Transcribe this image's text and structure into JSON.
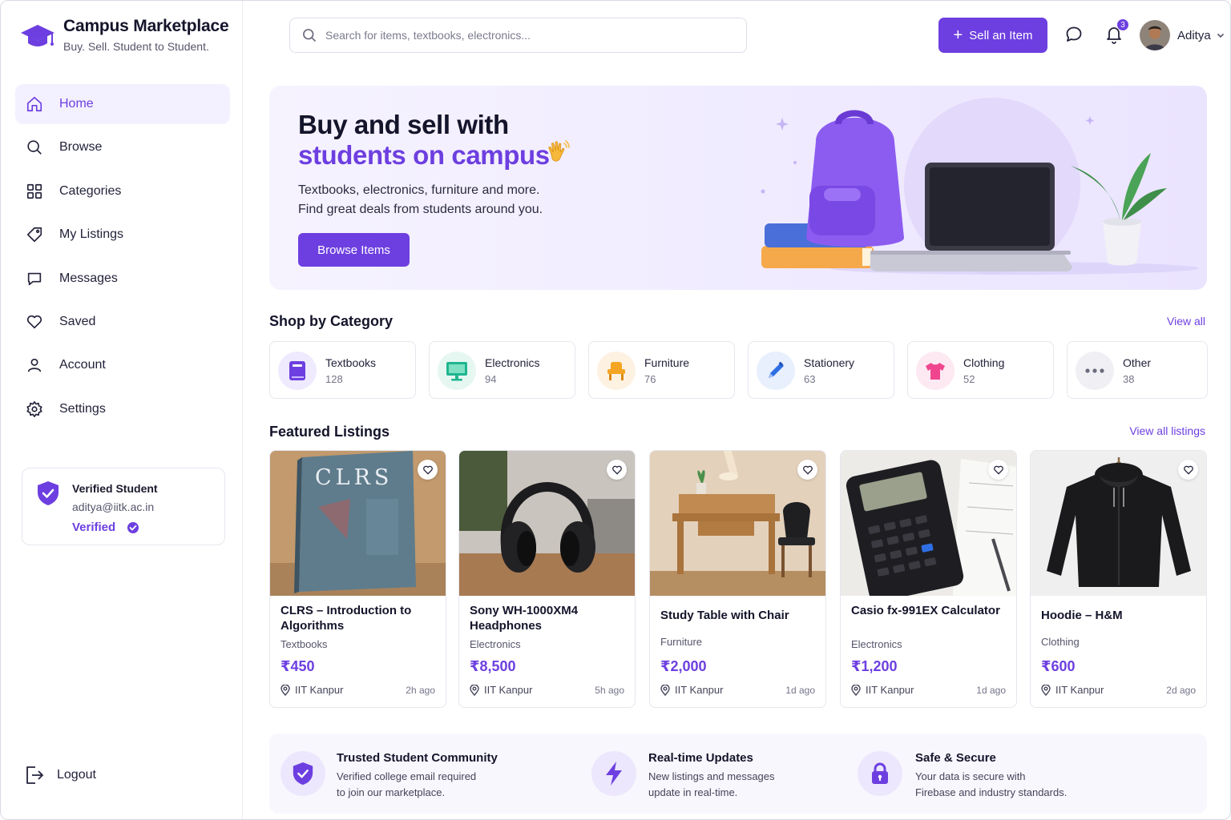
{
  "brand": {
    "title": "Campus Marketplace",
    "tagline": "Buy. Sell. Student to Student."
  },
  "nav": {
    "items": [
      {
        "label": "Home",
        "icon": "home-icon",
        "active": true
      },
      {
        "label": "Browse",
        "icon": "search-icon"
      },
      {
        "label": "Categories",
        "icon": "grid-icon"
      },
      {
        "label": "My Listings",
        "icon": "tag-icon"
      },
      {
        "label": "Messages",
        "icon": "chat-icon"
      },
      {
        "label": "Saved",
        "icon": "heart-icon"
      },
      {
        "label": "Account",
        "icon": "user-icon"
      },
      {
        "label": "Settings",
        "icon": "gear-icon"
      }
    ],
    "logout": "Logout"
  },
  "verified_card": {
    "title": "Verified Student",
    "email": "aditya@iitk.ac.in",
    "status": "Verified"
  },
  "header": {
    "search_placeholder": "Search for items, textbooks, electronics...",
    "sell_label": "Sell an Item",
    "notification_count": "3",
    "user_name": "Aditya"
  },
  "hero": {
    "line1": "Buy and sell with",
    "line2": "students on campus",
    "desc1": "Textbooks, electronics, furniture and more.",
    "desc2": "Find great deals from students around you.",
    "button": "Browse Items"
  },
  "categories": {
    "title": "Shop by Category",
    "view_all": "View all",
    "items": [
      {
        "name": "Textbooks",
        "count": "128",
        "icon": "book-icon",
        "color": "#6d3fe0",
        "bg": "#efeafe"
      },
      {
        "name": "Electronics",
        "count": "94",
        "icon": "monitor-icon",
        "color": "#1fb58f",
        "bg": "#e6f7f1"
      },
      {
        "name": "Furniture",
        "count": "76",
        "icon": "chair-icon",
        "color": "#f5a524",
        "bg": "#fdf1e2"
      },
      {
        "name": "Stationery",
        "count": "63",
        "icon": "pencil-icon",
        "color": "#2f6fe4",
        "bg": "#e8effd"
      },
      {
        "name": "Clothing",
        "count": "52",
        "icon": "tshirt-icon",
        "color": "#f0468f",
        "bg": "#fde9f2"
      },
      {
        "name": "Other",
        "count": "38",
        "icon": "more-icon",
        "color": "#6b6b80",
        "bg": "#f0f0f4"
      }
    ]
  },
  "featured": {
    "title": "Featured Listings",
    "view_all": "View all listings",
    "items": [
      {
        "title": "CLRS – Introduction to Algorithms",
        "category": "Textbooks",
        "price": "₹450",
        "location": "IIT Kanpur",
        "time": "2h ago",
        "image": "book-photo",
        "image_text": "CLRS"
      },
      {
        "title": "Sony WH-1000XM4 Headphones",
        "category": "Electronics",
        "price": "₹8,500",
        "location": "IIT Kanpur",
        "time": "5h ago",
        "image": "headphones-photo"
      },
      {
        "title": "Study Table with Chair",
        "category": "Furniture",
        "price": "₹2,000",
        "location": "IIT Kanpur",
        "time": "1d ago",
        "image": "table-photo"
      },
      {
        "title": "Casio fx-991EX Calculator",
        "category": "Electronics",
        "price": "₹1,200",
        "location": "IIT Kanpur",
        "time": "1d ago",
        "image": "calculator-photo"
      },
      {
        "title": "Hoodie – H&M",
        "category": "Clothing",
        "price": "₹600",
        "location": "IIT Kanpur",
        "time": "2d ago",
        "image": "hoodie-photo"
      }
    ]
  },
  "features": [
    {
      "title": "Trusted Student Community",
      "line1": "Verified college email required",
      "line2": "to join our marketplace.",
      "icon": "shield-check-icon"
    },
    {
      "title": "Real-time Updates",
      "line1": "New listings and messages",
      "line2": "update in real-time.",
      "icon": "bolt-icon"
    },
    {
      "title": "Safe & Secure",
      "line1": "Your data is secure with",
      "line2": "Firebase and industry standards.",
      "icon": "lock-icon"
    }
  ],
  "colors": {
    "accent": "#6d3fe0",
    "accent_light": "#f3f0ff"
  }
}
